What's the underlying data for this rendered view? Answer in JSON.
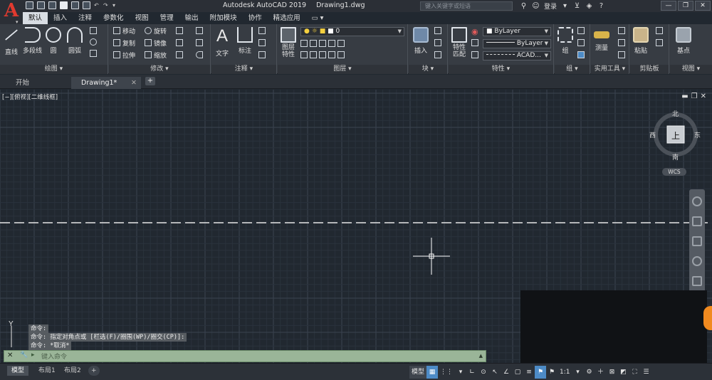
{
  "app": {
    "logo_letter": "A",
    "title": "Autodesk AutoCAD 2019",
    "document": "Drawing1.dwg",
    "search_placeholder": "键入关键字或短语",
    "login": "登录",
    "help": "?"
  },
  "ribbon_tabs": [
    "默认",
    "插入",
    "注释",
    "参数化",
    "视图",
    "管理",
    "输出",
    "附加模块",
    "协作",
    "精选应用"
  ],
  "ribbon_tab_extra": "▭ ▾",
  "panels": {
    "draw": {
      "title": "绘图 ▾",
      "tools": [
        "直线",
        "多段线",
        "圆",
        "圆弧"
      ]
    },
    "modify": {
      "title": "修改 ▾",
      "tools": [
        "移动",
        "旋转",
        "复制",
        "镜像",
        "拉伸",
        "缩放"
      ]
    },
    "annotation": {
      "title": "注释 ▾",
      "tools": [
        "文字",
        "标注"
      ]
    },
    "layers": {
      "title": "图层 ▾",
      "layer_props": "图层\n特性",
      "current_layer": "0"
    },
    "block": {
      "title": "块 ▾",
      "insert": "插入"
    },
    "properties": {
      "title": "特性 ▾",
      "match": "特性\n匹配",
      "color": "ByLayer",
      "linetype": "ByLayer",
      "lineweight": "ACAD..."
    },
    "groups": {
      "title": "组 ▾",
      "group": "组"
    },
    "utilities": {
      "title": "实用工具 ▾",
      "measure": "测量"
    },
    "clipboard": {
      "title": "剪贴板",
      "paste": "粘贴"
    },
    "view": {
      "title": "视图 ▾",
      "base": "基点"
    }
  },
  "doc_tabs": [
    {
      "label": "开始",
      "active": false
    },
    {
      "label": "Drawing1*",
      "active": true
    }
  ],
  "add_tab": "+",
  "viewport": {
    "label": "[−][俯视][二维线框]",
    "viewcube": {
      "top": "上",
      "north": "北",
      "south": "南",
      "east": "东",
      "west": "西"
    },
    "wcs": "WCS"
  },
  "command_history": [
    "命令:",
    "命令: 指定对角点或 [栏选(F)/圈围(WP)/圈交(CP)]:",
    "命令: *取消*"
  ],
  "command_line": {
    "placeholder": "键入命令"
  },
  "ucs_label": "Y",
  "layout_tabs": [
    {
      "label": "模型",
      "active": true
    },
    {
      "label": "布局1",
      "active": false
    },
    {
      "label": "布局2",
      "active": false
    }
  ],
  "status_bar": {
    "model": "模型",
    "scale": "1:1"
  },
  "colors": {
    "canvas": "#212830",
    "grid_major": "#3a4350",
    "grid_minor": "#2a323c",
    "dashed_line": "#e6e6e6",
    "command_bar": "#9ab598"
  }
}
